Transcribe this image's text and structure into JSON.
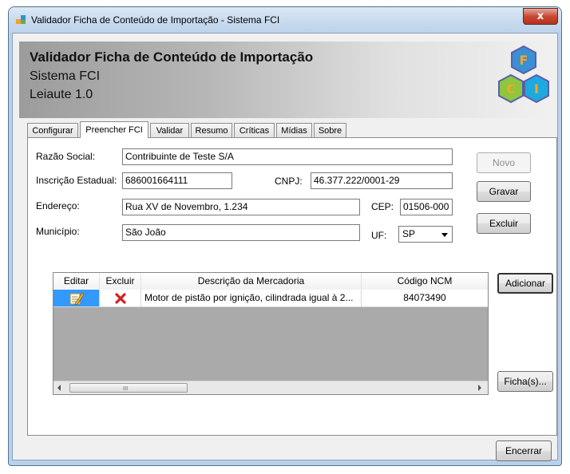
{
  "window": {
    "title": "Validador Ficha de Conteúdo de Importação - Sistema FCI",
    "close_symbol": "x",
    "app_icon": "window-app-icon"
  },
  "header": {
    "title": "Validador Ficha de Conteúdo de Importação",
    "subtitle": "Sistema FCI",
    "version": "Leiaute 1.0",
    "logo": {
      "letters": [
        "F",
        "C",
        "I"
      ],
      "colors": [
        "#f5a623",
        "#8dc63f",
        "#1ea9e1"
      ],
      "outline": "#5b5fa8"
    }
  },
  "tabs": [
    {
      "label": "Configurar"
    },
    {
      "label": "Preencher FCI"
    },
    {
      "label": "Validar"
    },
    {
      "label": "Resumo"
    },
    {
      "label": "Críticas"
    },
    {
      "label": "Mídias"
    },
    {
      "label": "Sobre"
    }
  ],
  "active_tab": "Preencher FCI",
  "form": {
    "razao_social_label": "Razão Social:",
    "razao_social_value": "Contribuinte de Teste S/A",
    "inscricao_label": "Inscrição Estadual:",
    "inscricao_value": "686001664111",
    "cnpj_label": "CNPJ:",
    "cnpj_value": "46.377.222/0001-29",
    "endereco_label": "Endereço:",
    "endereco_value": "Rua XV de Novembro, 1.234",
    "cep_label": "CEP:",
    "cep_value": "01506-000",
    "municipio_label": "Município:",
    "municipio_value": "São João",
    "uf_label": "UF:",
    "uf_value": "SP"
  },
  "buttons": {
    "novo": "Novo",
    "gravar": "Gravar",
    "excluir": "Excluir",
    "adicionar": "Adicionar",
    "fichas": "Ficha(s)...",
    "encerrar": "Encerrar"
  },
  "grid": {
    "columns": [
      "Editar",
      "Excluir",
      "Descrição da Mercadoria",
      "Código NCM"
    ],
    "rows": [
      {
        "descricao": "Motor de pistão por ignição, cilindrada igual à 2...",
        "ncm": "84073490"
      }
    ],
    "scroll_grip": "III"
  }
}
